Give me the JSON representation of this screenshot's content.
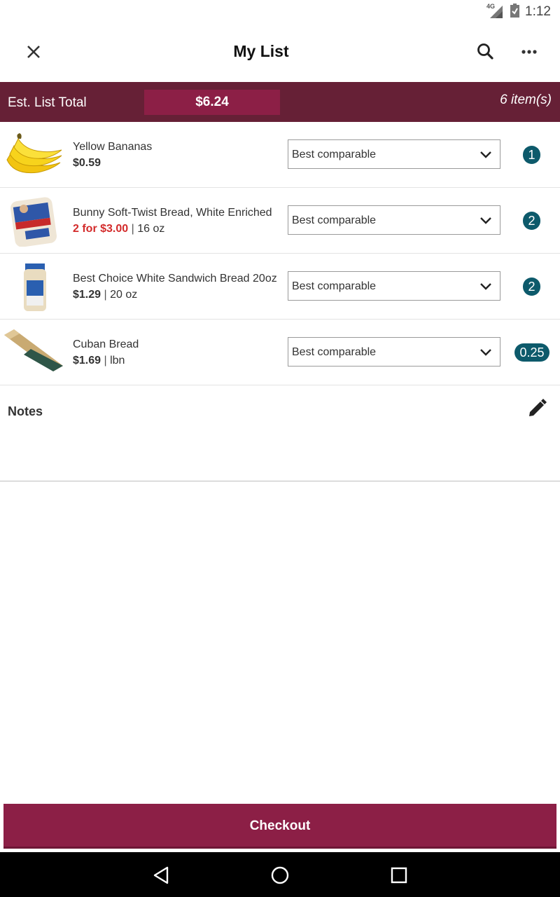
{
  "status_bar": {
    "network": "4G",
    "time": "1:12"
  },
  "app_bar": {
    "title": "My List",
    "close_icon": "close-icon",
    "search_icon": "search-icon",
    "more_icon": "more-horizontal-icon"
  },
  "summary": {
    "label": "Est. List Total",
    "total": "$6.24",
    "count": "6 item(s)"
  },
  "items": [
    {
      "name": "Yellow Bananas",
      "price": "$0.59",
      "price_sale": false,
      "size": "",
      "substitution": "Best comparable",
      "quantity": "1",
      "image": "bananas-image"
    },
    {
      "name": "Bunny Soft-Twist Bread, White Enriched",
      "price": "2 for $3.00",
      "price_sale": true,
      "size": "16 oz",
      "substitution": "Best comparable",
      "quantity": "2",
      "image": "bunny-bread-image"
    },
    {
      "name": "Best Choice White Sandwich Bread 20oz",
      "price": "$1.29",
      "price_sale": false,
      "size": "20 oz",
      "substitution": "Best comparable",
      "quantity": "2",
      "image": "sandwich-bread-image"
    },
    {
      "name": "Cuban Bread",
      "price": "$1.69",
      "price_sale": false,
      "size": "lbn",
      "substitution": "Best comparable",
      "quantity": "0.25",
      "image": "cuban-bread-image"
    }
  ],
  "notes": {
    "label": "Notes",
    "edit_icon": "pencil-icon"
  },
  "checkout": {
    "label": "Checkout"
  },
  "colors": {
    "header_bar": "#662036",
    "accent": "#8c1f46",
    "quantity_badge": "#0d5a6b",
    "sale_price": "#d32b2b"
  }
}
